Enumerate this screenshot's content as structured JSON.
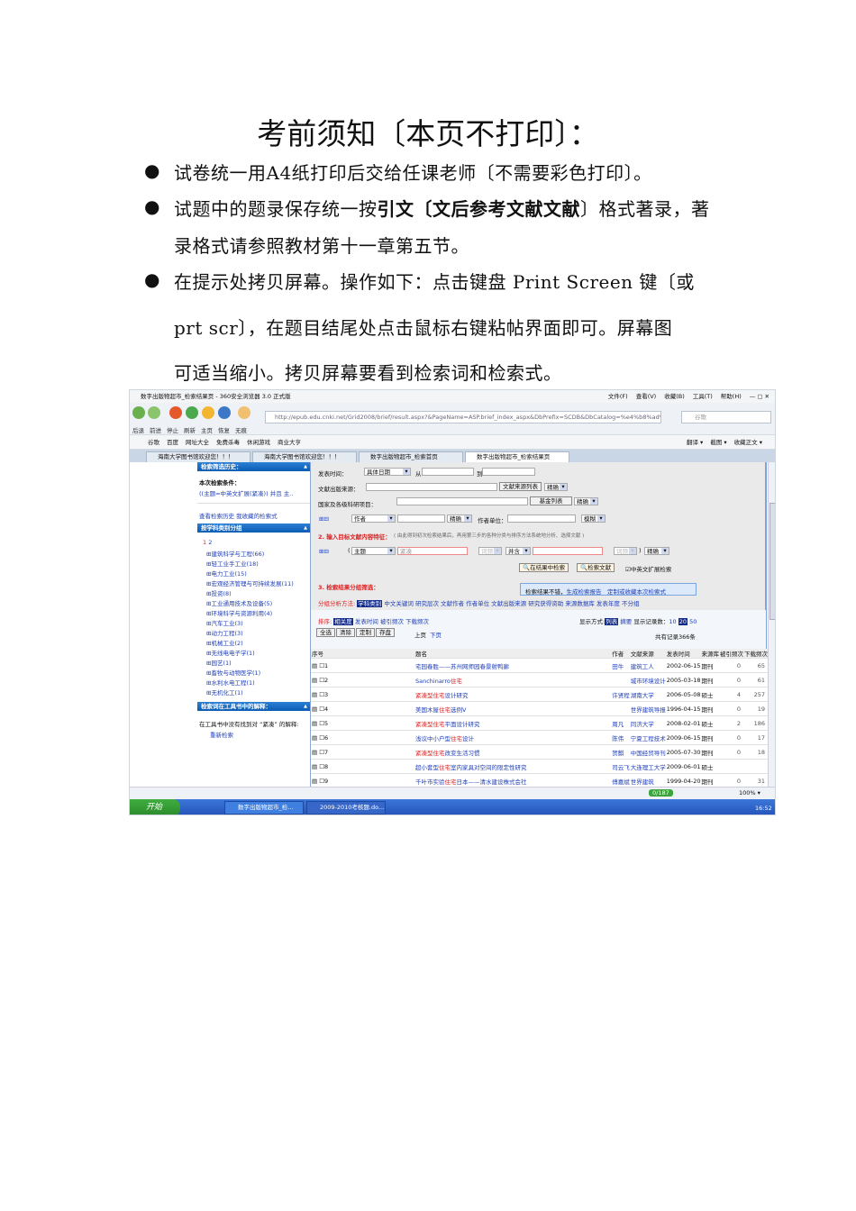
{
  "doc": {
    "title": "考前须知〔本页不打印〕：",
    "bullet": "●",
    "b1": "试卷统一用A4纸打印后交给任课老师〔不需要彩色打印〕。",
    "b2a": "试题中的题录保存统一按",
    "b2b": "引文〔文后参考文献",
    "b2c": "〕格式著录，著",
    "b2d": "录格式请参照教材第十一章第五节。",
    "b3a": "在提示处拷贝屏幕。操作如下：点击键盘 Print Screen 键〔或",
    "b3b": "prt scr〕，在题目结尾处点击鼠标右键粘帖界面即可。屏幕图",
    "b3c": "可适当缩小。拷贝屏幕要看到检索词和检索式。"
  },
  "browser": {
    "window_title": "数字出版物超市_检索结果页 - 360安全浏览器 3.0 正式版",
    "menu": [
      "文件(F)",
      "查看(V)",
      "收藏(B)",
      "工具(T)",
      "帮助(H)"
    ],
    "nav_labels": [
      "后退",
      "前进",
      "停止",
      "刷新",
      "主页",
      "恢复",
      "无痕"
    ],
    "url": "http://epub.edu.cnki.net/Grid2008/brief/result.aspx?&PageName=ASP.brief_index_aspx&DbPrefix=SCDB&DbCatalog=%e4%b8%ad%e!",
    "search_placeholder": "谷歌",
    "favorites": [
      "谷歌",
      "百度",
      "网址大全",
      "免费杀毒",
      "休闲游戏",
      "商业大亨"
    ],
    "fav_right": [
      "翻译 ▾",
      "截图 ▾",
      "收藏正文 ▾"
    ],
    "tabs": [
      "海南大学图书馆欢迎您！！！",
      "海南大学图书馆欢迎您！！！",
      "数字出版物超市_检索首页",
      "数字出版物超市_检索结果页"
    ],
    "status": [
      "0/187",
      "100% ▾"
    ],
    "taskbar": {
      "start": "开始",
      "items": [
        "数字出版物超市_检...",
        "2009-2010考核题.do..."
      ],
      "clock": "16:52"
    }
  },
  "sidebar": {
    "history_header": "检索筛选历史：",
    "condition_label": "本次检索条件：",
    "condition": "((主题=中英文扩展(紧凑)) 并且 主..",
    "history_links": [
      "查看检索历史",
      "我收藏的检索式"
    ],
    "group_header": "按学科类别分组",
    "pages": [
      "1",
      "2"
    ],
    "categories": [
      "建筑科学与工程(66)",
      "轻工业手工业(18)",
      "电力工业(15)",
      "宏观经济管理与可持续发展(11)",
      "投资(8)",
      "工业通用技术及设备(5)",
      "环境科学与资源利用(4)",
      "汽车工业(3)",
      "动力工程(3)",
      "机械工业(2)",
      "无线电电子学(1)",
      "园艺(1)",
      "畜牧与动物医学(1)",
      "水利水电工程(1)",
      "无机化工(1)"
    ],
    "tool_header": "检索词在工具书中的解释：",
    "tool_text": "在工具书中没有找到对 “紧凑” 的解释:",
    "tool_link": "重新检索"
  },
  "form": {
    "date_label": "发表时间：",
    "date_select": "具体日期",
    "from": "从",
    "to": "到",
    "source_label": "文献出版来源：",
    "source_btn": "文献来源列表",
    "exact": "精确",
    "fund_label": "国家及各级科研项目：",
    "fund_btn": "基金列表",
    "author_select": "作者",
    "org_label": "作者单位：",
    "fuzzy": "模糊",
    "step2": "2. 输入目标文献内容特征：",
    "step2_note": "( 由此得到初次检索结果后，再用第三步的各种分类与排序方法系统地分析、选择文献 )",
    "topic": "主题",
    "keyword": "紧凑",
    "freq": "词频",
    "and": "并含",
    "search_in_results": "在结果中检索",
    "search_btn": "检索文献",
    "expand": "中英文扩展检索",
    "step3": "3. 检索结果分组筛选：",
    "report_text": "检索结果不错，",
    "report_link1": "生成检索报告",
    "report_link2": "定制或收藏本次检索式",
    "group_label": "分组分析方法:",
    "groups": [
      "学科类别",
      "中文关键词",
      "研究层次",
      "文献作者",
      "作者单位",
      "文献出版来源",
      "研究获得资助",
      "来源数据库",
      "发表年度",
      "不分组"
    ],
    "sort_label": "排序:",
    "sorts": [
      "相关度",
      "发表时间",
      "被引频次",
      "下载频次"
    ],
    "display_label": "显示方式:",
    "display": [
      "列表",
      "摘要"
    ],
    "count_label": "显示记录数：",
    "counts": [
      "10",
      "20",
      "50"
    ],
    "actions": [
      "全选",
      "清除",
      "定制",
      "存盘"
    ],
    "prev": "上页",
    "next": "下页",
    "total": "共有记录366条"
  },
  "table": {
    "headers": [
      "序号",
      "题名",
      "作者",
      "文献来源",
      "发表时间",
      "来源库",
      "被引频次",
      "下载频次"
    ],
    "rows": [
      {
        "n": "1",
        "title": [
          [
            "宅园春胜——苏州网师园春景射鸭廊",
            0
          ]
        ],
        "author": "田牛",
        "source": "建筑工人",
        "date": "2002-06-15",
        "db": "期刊",
        "cited": "0",
        "dl": "65"
      },
      {
        "n": "2",
        "title": [
          [
            "Sanchinarro",
            0
          ],
          [
            "住宅",
            1
          ]
        ],
        "author": "",
        "source": "城市环境设计",
        "date": "2005-03-18",
        "db": "期刊",
        "cited": "0",
        "dl": "61"
      },
      {
        "n": "3",
        "title": [
          [
            "紧凑型住宅",
            1
          ],
          [
            "设计研究",
            0
          ]
        ],
        "author": "许贤程",
        "source": "湖南大学",
        "date": "2006-05-08",
        "db": "硕士",
        "cited": "4",
        "dl": "257"
      },
      {
        "n": "4",
        "title": [
          [
            "美国木屋",
            0
          ],
          [
            "住宅",
            1
          ],
          [
            "选例V",
            0
          ]
        ],
        "author": "",
        "source": "世界建筑导报",
        "date": "1996-04-15",
        "db": "期刊",
        "cited": "0",
        "dl": "19"
      },
      {
        "n": "5",
        "title": [
          [
            "紧凑型住宅",
            1
          ],
          [
            "平面设计研究",
            0
          ]
        ],
        "author": "周凡",
        "source": "同济大学",
        "date": "2008-02-01",
        "db": "硕士",
        "cited": "2",
        "dl": "186"
      },
      {
        "n": "6",
        "title": [
          [
            "浅议中小户型",
            0
          ],
          [
            "住宅",
            1
          ],
          [
            "设计",
            0
          ]
        ],
        "author": "陈伟",
        "source": "宁夏工程技术",
        "date": "2009-06-15",
        "db": "期刊",
        "cited": "0",
        "dl": "17"
      },
      {
        "n": "7",
        "title": [
          [
            "紧凑型住宅",
            1
          ],
          [
            "改变生活习惯",
            0
          ]
        ],
        "author": "贺麒",
        "source": "中国经贸导刊",
        "date": "2005-07-30",
        "db": "期刊",
        "cited": "0",
        "dl": "18"
      },
      {
        "n": "8",
        "title": [
          [
            "超小套型",
            0
          ],
          [
            "住宅",
            1
          ],
          [
            "室内家具对空间的限定性研究",
            0
          ]
        ],
        "author": "司云飞",
        "source": "大连理工大学",
        "date": "2009-06-01",
        "db": "硕士",
        "cited": "",
        "dl": ""
      },
      {
        "n": "9",
        "title": [
          [
            "千叶市实验",
            0
          ],
          [
            "住宅",
            1
          ],
          [
            "日本——清水建设株式会社",
            0
          ]
        ],
        "author": "傅嘉斌",
        "source": "世界建筑",
        "date": "1999-04-20",
        "db": "期刊",
        "cited": "0",
        "dl": "31"
      }
    ]
  },
  "colors": {
    "accent": "#0b5cb3",
    "highlight": "#dd2222",
    "link": "#1f3fb8"
  }
}
